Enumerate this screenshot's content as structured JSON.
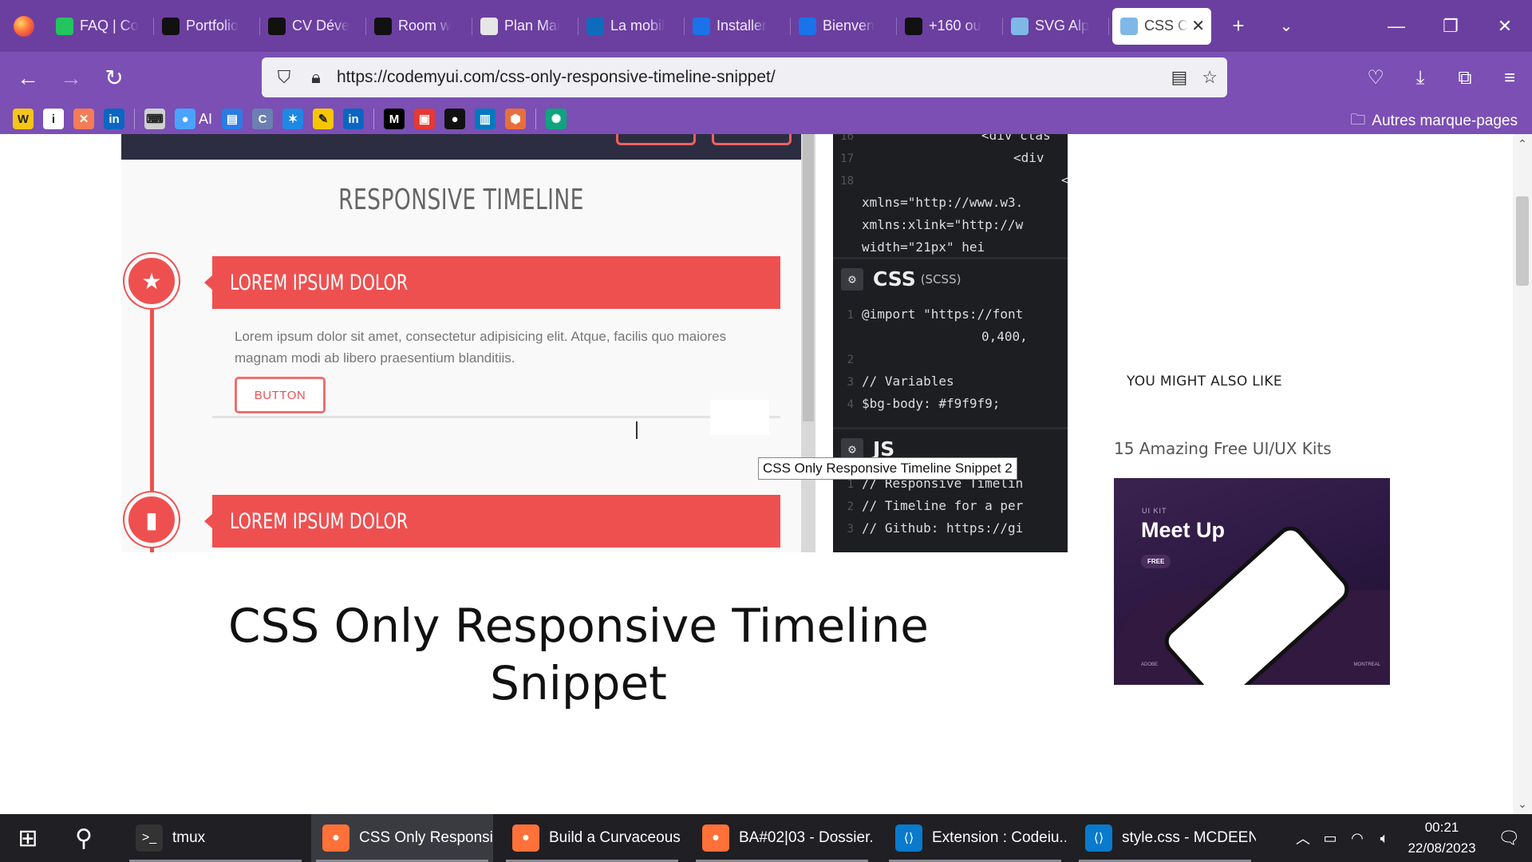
{
  "browser": {
    "tabs": [
      {
        "label": "FAQ | Co",
        "icon": "bracket-icon",
        "color": "#22c55e"
      },
      {
        "label": "Portfolio",
        "icon": "slash-logo-icon",
        "color": "#111111"
      },
      {
        "label": "CV Déve",
        "icon": "slash-logo-icon",
        "color": "#111111"
      },
      {
        "label": "Room w",
        "icon": "tv-icon",
        "color": "#111111"
      },
      {
        "label": "Plan Mai",
        "icon": "document-icon",
        "color": "#e6e6e6"
      },
      {
        "label": "La mobil",
        "icon": "edge-icon",
        "color": "#0f6cbd"
      },
      {
        "label": "Installer",
        "icon": "video-icon",
        "color": "#1a73e8"
      },
      {
        "label": "Bienven",
        "icon": "video-icon",
        "color": "#1a73e8"
      },
      {
        "label": "+160 ou",
        "icon": "slash-logo-icon",
        "color": "#111111"
      },
      {
        "label": "SVG Alp",
        "icon": "image-icon",
        "color": "#7fb8e6"
      },
      {
        "label": "CSS C",
        "icon": "image-icon",
        "color": "#7fb8e6",
        "active": true
      }
    ],
    "url": "https://codemyui.com/css-only-responsive-timeline-snippet/",
    "bookmarks": [
      {
        "icon": "w-icon",
        "color": "#f5c518",
        "text": "W"
      },
      {
        "icon": "info-icon",
        "color": "#ffffff",
        "text": "i"
      },
      {
        "icon": "design-icon",
        "color": "#f47c57",
        "text": "✕"
      },
      {
        "icon": "linkedin-icon",
        "color": "#0a66c2",
        "text": "in"
      },
      {
        "icon": "keyboard-icon",
        "color": "#cfcfcf",
        "text": "⌨"
      },
      {
        "icon": "ai-icon",
        "color": "#4aa3ff",
        "text": "●",
        "label": "AI"
      },
      {
        "icon": "calendar-icon",
        "color": "#2c7be5",
        "text": "▤"
      },
      {
        "icon": "c-icon",
        "color": "#6b7fb2",
        "text": "C"
      },
      {
        "icon": "star-app-icon",
        "color": "#1e88e5",
        "text": "✶"
      },
      {
        "icon": "pencil-icon",
        "color": "#f7c600",
        "text": "✎"
      },
      {
        "icon": "linkedin-icon",
        "color": "#0a66c2",
        "text": "in"
      },
      {
        "icon": "medium-icon",
        "color": "#000000",
        "text": "M"
      },
      {
        "icon": "bus-icon",
        "color": "#e53935",
        "text": "▣"
      },
      {
        "icon": "github-icon",
        "color": "#111111",
        "text": "●"
      },
      {
        "icon": "trello-icon",
        "color": "#0079bf",
        "text": "▥"
      },
      {
        "icon": "hex-icon",
        "color": "#e96e3d",
        "text": "⬢"
      },
      {
        "icon": "chatgpt-icon",
        "color": "#10a37f",
        "text": "✺"
      }
    ],
    "other_bookmarks": "Autres marque-pages"
  },
  "demo": {
    "timeline_title": "RESPONSIVE TIMELINE",
    "items": [
      {
        "heading": "LOREM IPSUM DOLOR",
        "icon": "star-icon"
      },
      {
        "heading": "LOREM IPSUM DOLOR",
        "icon": "book-icon"
      }
    ],
    "body_text": "Lorem ipsum dolor sit amet, consectetur adipisicing elit. Atque, facilis quo maiores magnam modi ab libero praesentium blanditiis.",
    "button_label": "BUTTON",
    "tooltip": "CSS Only Responsive Timeline Snippet 2",
    "editor": {
      "html_lines": [
        {
          "n": "16",
          "text": "<div clas"
        },
        {
          "n": "17",
          "text": "<div"
        },
        {
          "n": "18",
          "text": "<"
        },
        {
          "n": "",
          "text": "xmlns=\"http://www.w3."
        },
        {
          "n": "",
          "text": "xmlns:xlink=\"http://w"
        },
        {
          "n": "",
          "text": "width=\"21px\" hei"
        }
      ],
      "css_title": "CSS",
      "css_sub": "(SCSS)",
      "css_lines": [
        {
          "n": "1",
          "text": "@import \"https://font"
        },
        {
          "n": "",
          "text": "0,400,"
        },
        {
          "n": "2",
          "text": ""
        },
        {
          "n": "3",
          "text": "// Variables"
        },
        {
          "n": "4",
          "text": "$bg-body: #f9f9f9;"
        }
      ],
      "js_title": "JS",
      "js_lines": [
        {
          "n": "1",
          "text": "// Responsive Timelin"
        },
        {
          "n": "2",
          "text": "// Timeline for a per"
        },
        {
          "n": "3",
          "text": "// Github: https://gi"
        }
      ]
    }
  },
  "post_title": "CSS Only Responsive Timeline Snippet",
  "sidebar": {
    "section_label": "YOU MIGHT ALSO LIKE",
    "link": "15 Amazing Free UI/UX Kits",
    "card": {
      "kit": "UI KIT",
      "name": "Meet Up",
      "badge": "FREE",
      "foot_left": "ADOBE",
      "foot_right": "MONTREAL"
    }
  },
  "taskbar": {
    "tasks": [
      {
        "label": "tmux",
        "icon": "terminal-icon",
        "color": "#333333"
      },
      {
        "label": "CSS Only Responsi...",
        "icon": "firefox-icon",
        "color": "#ff7139",
        "active": true
      },
      {
        "label": "Build a Curvaceous ...",
        "icon": "firefox-icon",
        "color": "#ff7139"
      },
      {
        "label": "BA#02|03 - Dossier...",
        "icon": "firefox-icon",
        "color": "#ff7139"
      },
      {
        "label": "Extension : Codeiu...",
        "icon": "vscode-icon",
        "color": "#0a7acc"
      },
      {
        "label": "style.css - MCDEEN...",
        "icon": "vscode-icon",
        "color": "#0a7acc"
      }
    ],
    "time": "00:21",
    "date": "22/08/2023"
  }
}
